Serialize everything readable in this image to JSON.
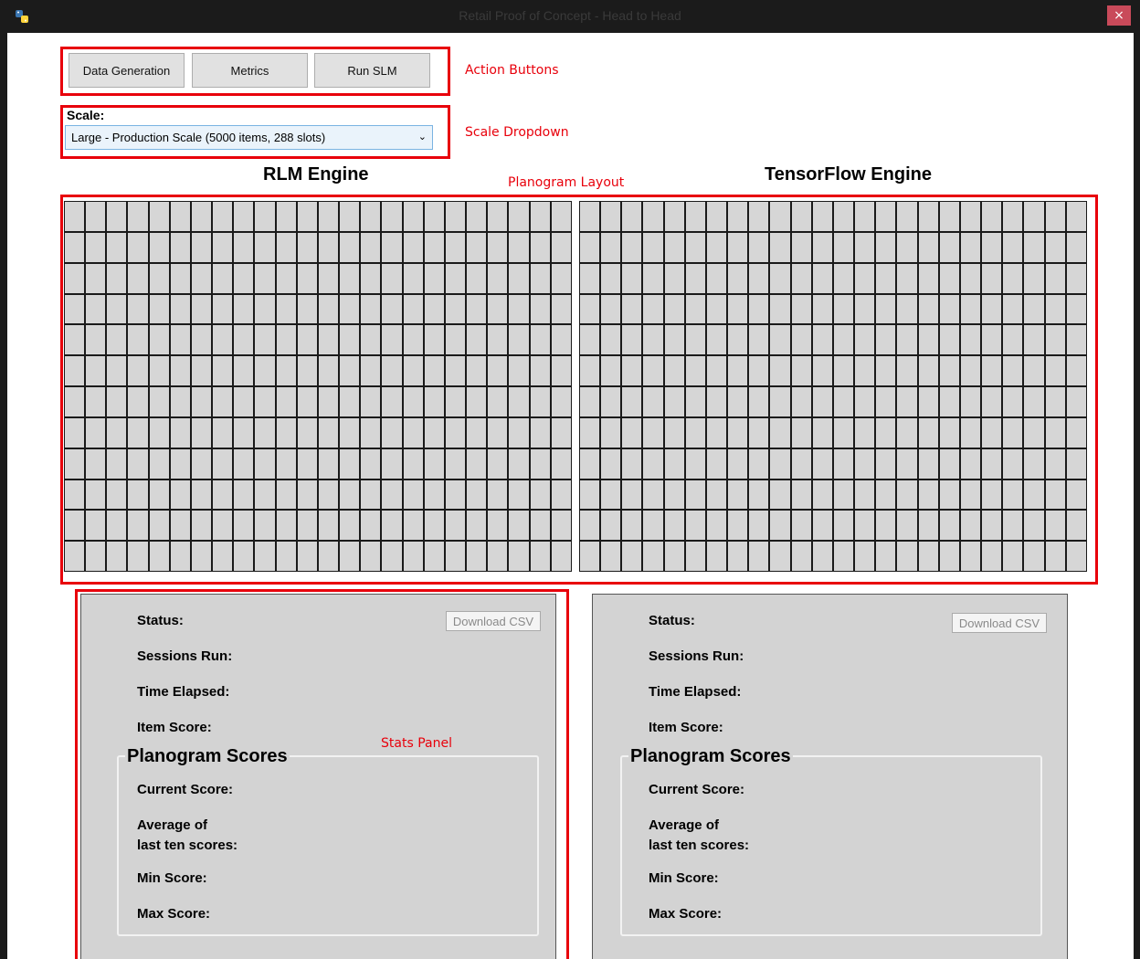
{
  "window": {
    "title": "Retail Proof of Concept - Head to Head",
    "close_label": "×"
  },
  "actions": {
    "buttons": [
      "Data Generation",
      "Metrics",
      "Run SLM"
    ]
  },
  "scale": {
    "label": "Scale:",
    "selected": "Large - Production Scale (5000 items, 288 slots)"
  },
  "engines": {
    "left": "RLM Engine",
    "right": "TensorFlow Engine"
  },
  "planogram": {
    "rows": 12,
    "cols": 24
  },
  "stats": {
    "status": "Status:",
    "sessions": "Sessions Run:",
    "time": "Time Elapsed:",
    "item": "Item Score:",
    "download": "Download CSV",
    "group_title": "Planogram Scores",
    "current": "Current Score:",
    "avg_line1": "Average of",
    "avg_line2": "last ten scores:",
    "min": "Min Score:",
    "max": "Max Score:"
  },
  "annotations": {
    "action_buttons": "Action Buttons",
    "scale_dropdown": "Scale Dropdown",
    "planogram_layout": "Planogram Layout",
    "stats_panel": "Stats Panel"
  },
  "colors": {
    "annotation": "#e8000b",
    "panel": "#d3d3d3",
    "cell": "#d6d6d6"
  }
}
